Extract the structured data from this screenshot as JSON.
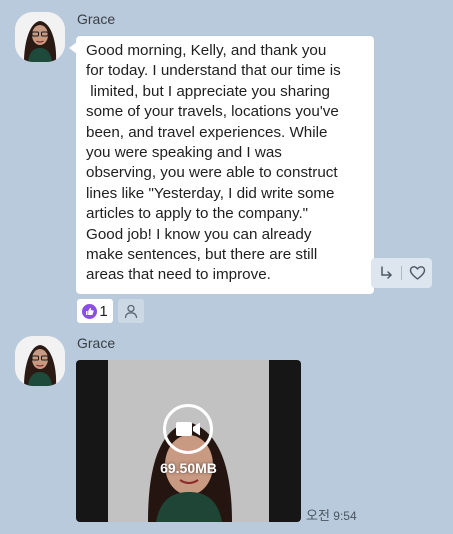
{
  "messages": [
    {
      "sender": "Grace",
      "avatar_icon": "profile-photo",
      "lines": [
        "Good morning, Kelly, and thank you",
        "for today. I understand that our time is",
        " limited, but I appreciate you sharing",
        "some of your travels, locations you've",
        "been, and travel experiences. While",
        "you were speaking and I was",
        "observing, you were able to construct",
        "lines like \"Yesterday, I did write some",
        "articles to apply to the company.\"",
        "Good job! I know you can already",
        "make sentences, but there are still",
        "areas that need to improve."
      ],
      "actions": {
        "reply_icon": "reply-arrow-icon",
        "like_icon": "heart-outline-icon"
      },
      "reaction": {
        "icon": "thumbs-up-icon",
        "color": "#8a4fe0",
        "count": "1"
      },
      "reader_icon": "person-icon"
    },
    {
      "sender": "Grace",
      "avatar_icon": "profile-photo",
      "video": {
        "icon": "video-camera-icon",
        "size": "69.50MB"
      },
      "time": {
        "ampm": "오전",
        "clock": "9:54"
      }
    }
  ],
  "colors": {
    "background": "#b8cadb",
    "bubble": "#ffffff",
    "accent_reaction": "#8a4fe0"
  }
}
